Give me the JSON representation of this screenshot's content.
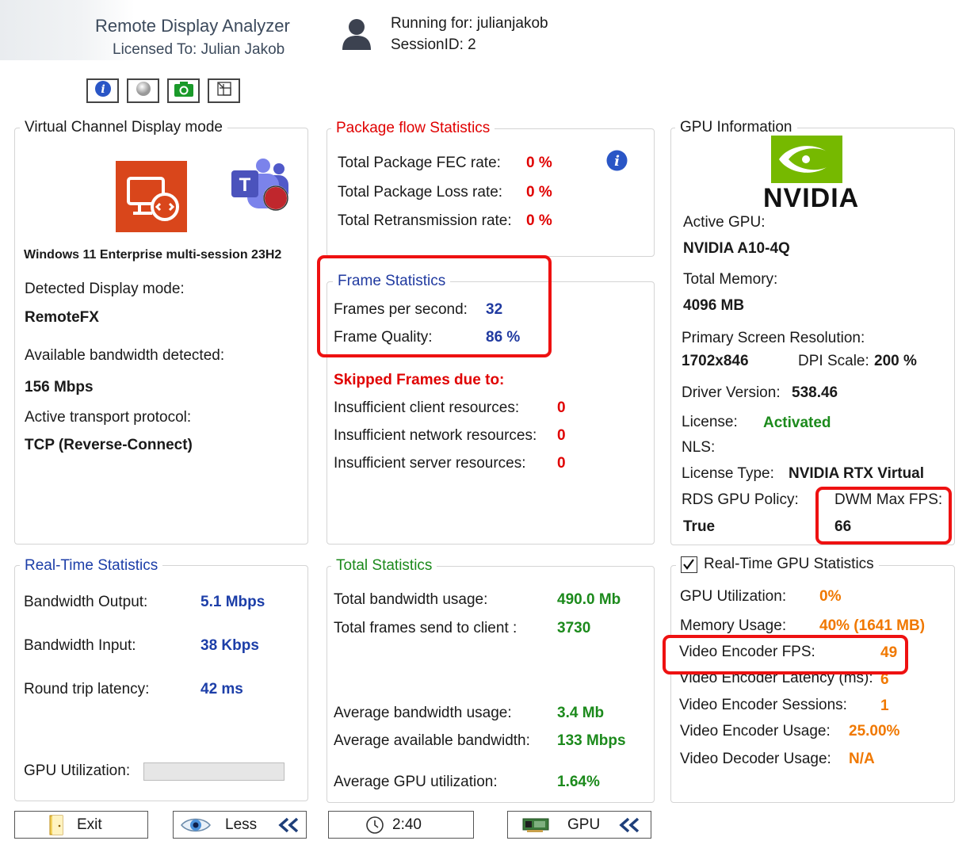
{
  "header": {
    "app_title": "Remote Display Analyzer",
    "licensed_to": "Licensed To: Julian Jakob",
    "running_for": "Running for: julianjakob",
    "session_id": "SessionID: 2"
  },
  "toolbar": {
    "buttons": [
      {
        "icon": "info-icon"
      },
      {
        "icon": "ball-icon"
      },
      {
        "icon": "camera-icon"
      },
      {
        "icon": "resize-icon"
      }
    ]
  },
  "virtual_channel": {
    "title": "Virtual Channel Display mode",
    "os_name": "Windows 11 Enterprise multi-session 23H2",
    "detected_label": "Detected Display mode:",
    "detected_value": "RemoteFX",
    "bandwidth_label": "Available bandwidth detected:",
    "bandwidth_value": "156 Mbps",
    "transport_label": "Active transport protocol:",
    "transport_value": "TCP (Reverse-Connect)"
  },
  "package_flow": {
    "title": "Package flow Statistics",
    "fec_label": "Total Package FEC rate:",
    "fec_value": "0 %",
    "loss_label": "Total Package Loss rate:",
    "loss_value": "0 %",
    "retrans_label": "Total Retransmission rate:",
    "retrans_value": "0 %"
  },
  "frame_stats": {
    "title": "Frame Statistics",
    "fps_label": "Frames per second:",
    "fps_value": "32",
    "quality_label": "Frame Quality:",
    "quality_value": "86 %",
    "skipped_title": "Skipped Frames due to:",
    "client_label": "Insufficient client resources:",
    "client_value": "0",
    "network_label": "Insufficient network resources:",
    "network_value": "0",
    "server_label": "Insufficient server resources:",
    "server_value": "0"
  },
  "gpu_info": {
    "title": "GPU Information",
    "logo_text": "NVIDIA",
    "active_gpu_label": "Active GPU:",
    "active_gpu_value": "NVIDIA A10-4Q",
    "total_memory_label": "Total Memory:",
    "total_memory_value": "4096 MB",
    "resolution_label": "Primary Screen Resolution:",
    "resolution_value": "1702x846",
    "dpi_label": "DPI Scale:",
    "dpi_value": "200 %",
    "driver_label": "Driver Version:",
    "driver_value": "538.46",
    "license_label": "License:",
    "license_value": "Activated",
    "nls_label": "NLS:",
    "license_type_label": "License Type:",
    "license_type_value": "NVIDIA RTX Virtual W",
    "rds_policy_label": "RDS GPU Policy:",
    "rds_policy_value": "True",
    "dwm_label": "DWM Max FPS:",
    "dwm_value": "66"
  },
  "realtime": {
    "title": "Real-Time Statistics",
    "bw_out_label": "Bandwidth Output:",
    "bw_out_value": "5.1 Mbps",
    "bw_in_label": "Bandwidth Input:",
    "bw_in_value": "38 Kbps",
    "rtt_label": "Round trip latency:",
    "rtt_value": "42 ms",
    "gpu_util_label": "GPU Utilization:",
    "gpu_util_fraction": 0
  },
  "total_stats": {
    "title": "Total Statistics",
    "bw_usage_label": "Total bandwidth usage:",
    "bw_usage_value": "490.0 Mb",
    "frames_label": "Total frames send to client :",
    "frames_value": "3730",
    "avg_bw_label": "Average bandwidth usage:",
    "avg_bw_value": "3.4 Mb",
    "avg_avail_label": "Average available bandwidth:",
    "avg_avail_value": "133 Mbps",
    "avg_gpu_label": "Average GPU utilization:",
    "avg_gpu_value": "1.64%"
  },
  "rt_gpu": {
    "title": "Real-Time GPU Statistics",
    "checked": true,
    "util_label": "GPU Utilization:",
    "util_value": "0%",
    "mem_label": "Memory Usage:",
    "mem_value": "40% (1641 MB)",
    "enc_fps_label": "Video Encoder FPS:",
    "enc_fps_value": "49",
    "enc_lat_label": "Video Encoder Latency (ms):",
    "enc_lat_value": "6",
    "enc_sess_label": "Video Encoder Sessions:",
    "enc_sess_value": "1",
    "enc_usage_label": "Video Encoder Usage:",
    "enc_usage_value": "25.00%",
    "dec_usage_label": "Video Decoder Usage:",
    "dec_usage_value": "N/A"
  },
  "bottom_buttons": {
    "exit": "Exit",
    "less": "Less",
    "timer": "2:40",
    "gpu": "GPU"
  },
  "colors": {
    "highlight": "#ee1111",
    "red_text": "#e00000",
    "blue_text": "#1c3ea8",
    "green_text": "#1c8a1c",
    "orange_text": "#f07800",
    "nvidia_green": "#76b900",
    "rd_orange": "#d9461b"
  }
}
